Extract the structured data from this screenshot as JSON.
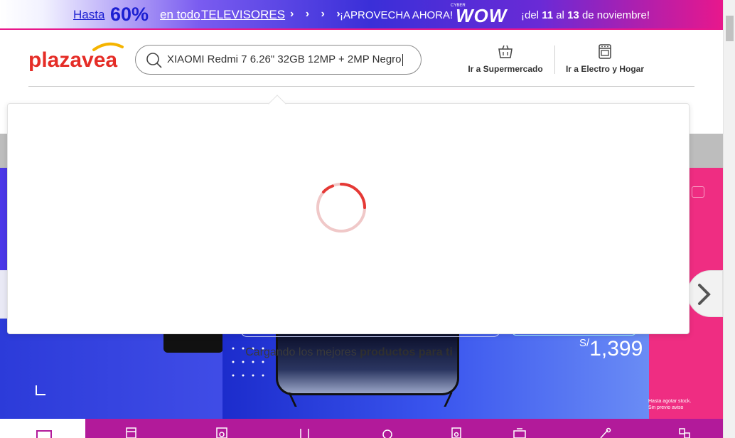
{
  "promo": {
    "hasta": "Hasta",
    "percent": "60%",
    "en_todo": "en todo",
    "category": "TELEVISORES",
    "arrows": "› › › ›",
    "aprovecha": "¡APROVECHA AHORA!",
    "cyber_small": "CYBER",
    "wow": "WOW",
    "del": "¡del",
    "day_from": "11",
    "al": "al",
    "day_to": "13",
    "month": "de noviembre!"
  },
  "header": {
    "logo_text": "plazavea",
    "search": {
      "value": "XIAOMI Redmi 7 6.26\" 32GB 12MP + 2MP Negro"
    },
    "nav": {
      "supermercado": "Ir a Supermercado",
      "electro": "Ir a Electro y Hogar"
    }
  },
  "dropdown": {
    "loading_prefix": "Cargando los mejores ",
    "loading_bold": "productos para ti"
  },
  "background": {
    "price_currency": "S/",
    "price_value": "1,399",
    "fine_print_1": "Hasta agotar stock.",
    "fine_print_2": "Sin previo aviso"
  },
  "colors": {
    "brand_red": "#e52d27",
    "brand_yellow": "#f5b400",
    "accent_pink": "#e8178c",
    "spinner": "#e53935"
  }
}
